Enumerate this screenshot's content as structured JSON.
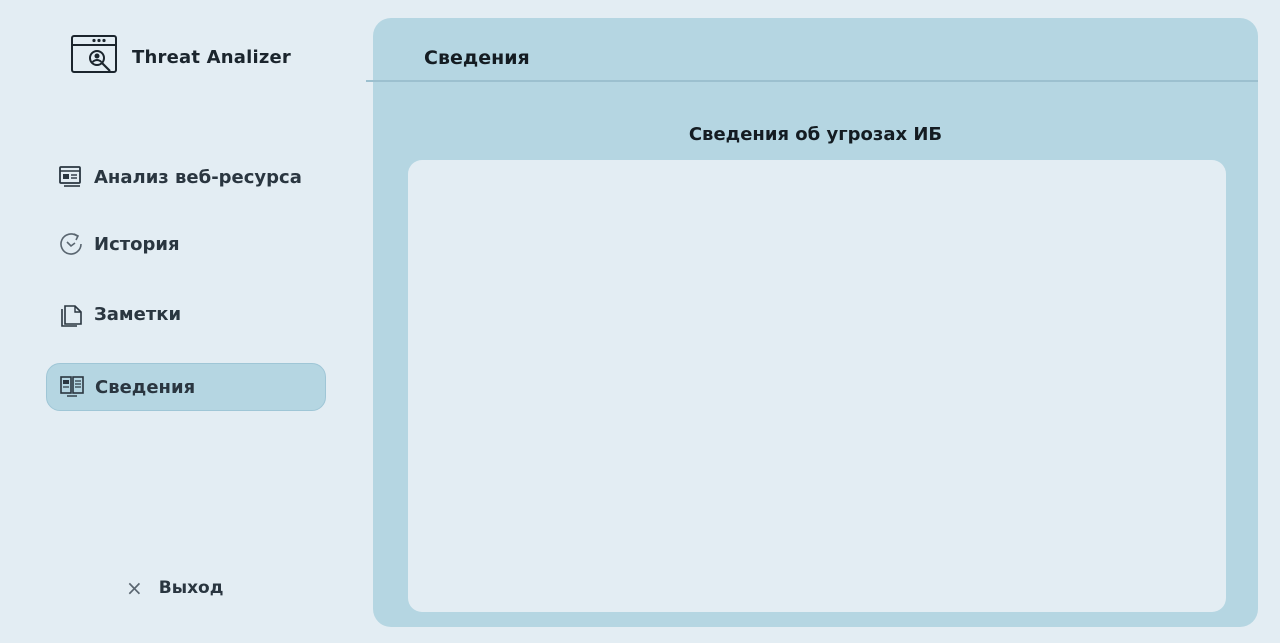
{
  "app": {
    "title": "Threat Analizer"
  },
  "sidebar": {
    "items": [
      {
        "label": "Анализ веб-ресурса",
        "icon": "web-analysis-icon",
        "active": false
      },
      {
        "label": "История",
        "icon": "history-icon",
        "active": false
      },
      {
        "label": "Заметки",
        "icon": "notes-icon",
        "active": false
      },
      {
        "label": "Сведения",
        "icon": "info-book-icon",
        "active": true
      }
    ],
    "logout": {
      "label": "Выход",
      "icon": "close-icon"
    }
  },
  "main": {
    "header_title": "Сведения",
    "section_title": "Сведения об угрозах ИБ"
  },
  "colors": {
    "background": "#e3edf3",
    "panel": "#b5d6e2",
    "active_item": "#b5d6e2",
    "text": "#1a2630"
  }
}
